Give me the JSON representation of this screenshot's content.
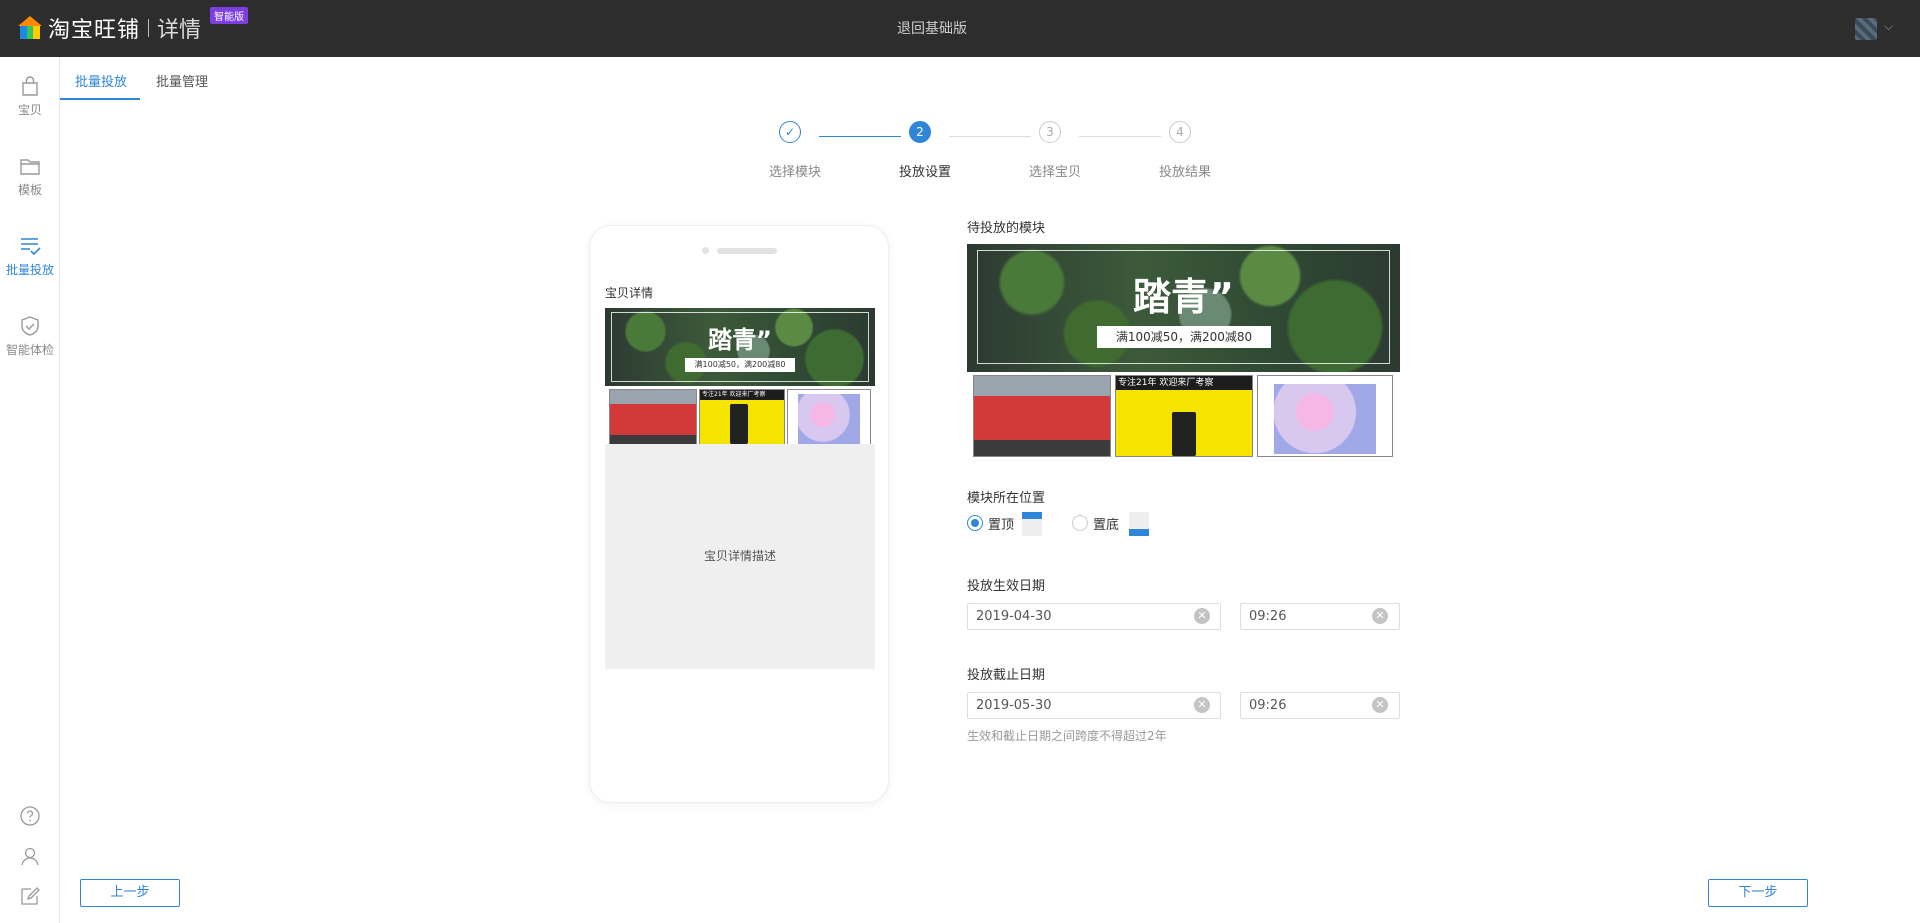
{
  "topbar": {
    "brand_name": "淘宝旺铺",
    "brand_sub": "详情",
    "badge": "智能版",
    "back_basic": "退回基础版"
  },
  "sidebar": {
    "items": [
      {
        "label": "宝贝",
        "icon": "bag-icon"
      },
      {
        "label": "模板",
        "icon": "folder-icon"
      },
      {
        "label": "批量投放",
        "icon": "list-check-icon",
        "active": true
      },
      {
        "label": "智能体检",
        "icon": "shield-check-icon"
      }
    ],
    "bottom_icons": [
      "help-icon",
      "user-icon",
      "edit-icon"
    ]
  },
  "tabs": [
    {
      "label": "批量投放",
      "active": true
    },
    {
      "label": "批量管理",
      "active": false
    }
  ],
  "steps": [
    {
      "number": "✓",
      "label": "选择模块",
      "state": "done"
    },
    {
      "number": "2",
      "label": "投放设置",
      "state": "current"
    },
    {
      "number": "3",
      "label": "选择宝贝",
      "state": "todo"
    },
    {
      "number": "4",
      "label": "投放结果",
      "state": "todo"
    }
  ],
  "preview": {
    "title": "宝贝详情",
    "desc_placeholder": "宝贝详情描述"
  },
  "module": {
    "label": "待投放的模块",
    "banner_headline": "踏青”",
    "banner_sub": "满100减50，满200减80",
    "product_yellow_header": "专注21年 欢迎来厂考察"
  },
  "position": {
    "label": "模块所在位置",
    "options": [
      {
        "label": "置顶",
        "checked": true
      },
      {
        "label": "置底",
        "checked": false
      }
    ]
  },
  "start": {
    "label": "投放生效日期",
    "date": "2019-04-30",
    "time": "09:26"
  },
  "end": {
    "label": "投放截止日期",
    "date": "2019-05-30",
    "time": "09:26",
    "hint": "生效和截止日期之间跨度不得超过2年"
  },
  "footer": {
    "prev": "上一步",
    "next": "下一步"
  },
  "colors": {
    "accent": "#2f86d8",
    "topbar": "#2d2d2d",
    "badge": "#7b3fe4"
  }
}
